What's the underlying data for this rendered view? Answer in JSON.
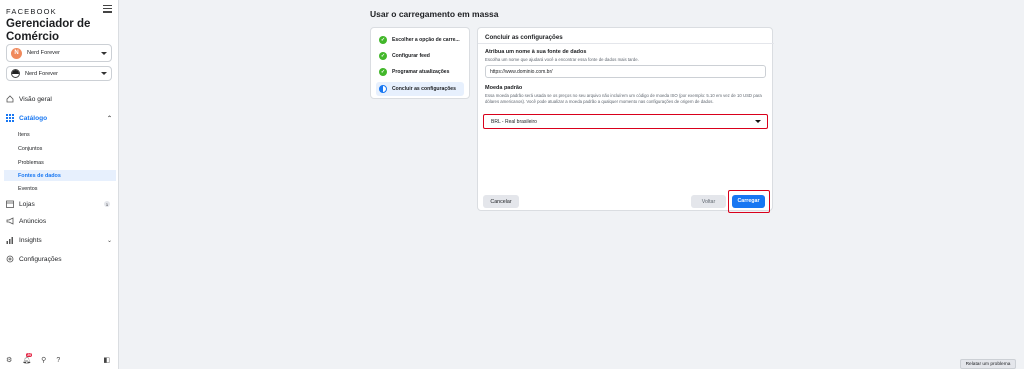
{
  "sidebar": {
    "brand": "FACEBOOK",
    "title": "Gerenciador de Comércio",
    "account": {
      "initial": "N",
      "name": "Nerd Forever"
    },
    "page": {
      "name": "Nerd Forever"
    },
    "nav": {
      "overview": "Visão geral",
      "catalog": "Catálogo",
      "catalog_items": [
        "Itens",
        "Conjuntos",
        "Problemas",
        "Fontes de dados",
        "Eventos"
      ],
      "stores": "Lojas",
      "stores_badge": "1",
      "ads": "Anúncios",
      "insights": "Insights",
      "settings": "Configurações"
    },
    "footer": {
      "notifications_badge": "20"
    }
  },
  "main": {
    "title": "Usar o carregamento em massa",
    "steps": [
      "Escolher a opção de carre...",
      "Configurar feed",
      "Programar atualizações",
      "Concluir as configurações"
    ],
    "form": {
      "title": "Concluir as configurações",
      "name_label": "Atribua um nome à sua fonte de dados",
      "name_help": "Escolha um nome que ajudará você a encontrar essa fonte de dados mais tarde.",
      "name_value": "https://www.dominio.com.br/",
      "currency_label": "Moeda padrão",
      "currency_help": "Essa moeda padrão será usada se os preços no seu arquivo não incluírem um código de moeda ISO (por exemplo: 5.10 em vez de 10 USD para dólares americanos). Você pode atualizar a moeda padrão a qualquer momento nas configurações de origem de dados.",
      "currency_value": "BRL - Real brasileiro",
      "cancel": "Cancelar",
      "back": "Voltar",
      "upload": "Carregar"
    }
  },
  "report_problem": "Relatar um problema",
  "colors": {
    "accent": "#1877f2",
    "highlight": "#d9001b",
    "success": "#42b72a"
  }
}
